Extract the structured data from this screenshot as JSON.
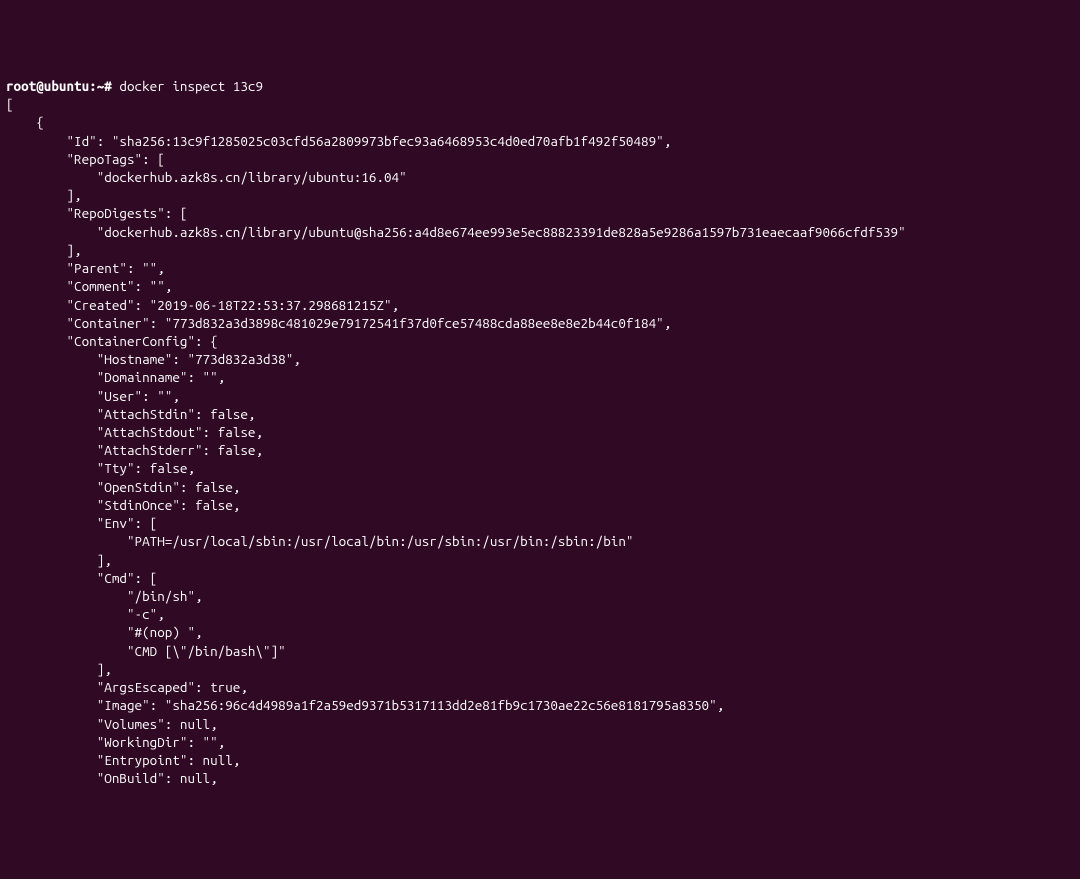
{
  "prompt": "root@ubuntu:~# ",
  "command": "docker inspect 13c9",
  "lines": [
    "[",
    "    {",
    "        \"Id\": \"sha256:13c9f1285025c03cfd56a2809973bfec93a6468953c4d0ed70afb1f492f50489\",",
    "        \"RepoTags\": [",
    "            \"dockerhub.azk8s.cn/library/ubuntu:16.04\"",
    "        ],",
    "        \"RepoDigests\": [",
    "            \"dockerhub.azk8s.cn/library/ubuntu@sha256:a4d8e674ee993e5ec88823391de828a5e9286a1597b731eaecaaf9066cfdf539\"",
    "        ],",
    "        \"Parent\": \"\",",
    "        \"Comment\": \"\",",
    "        \"Created\": \"2019-06-18T22:53:37.298681215Z\",",
    "        \"Container\": \"773d832a3d3898c481029e79172541f37d0fce57488cda88ee8e8e2b44c0f184\",",
    "        \"ContainerConfig\": {",
    "            \"Hostname\": \"773d832a3d38\",",
    "            \"Domainname\": \"\",",
    "            \"User\": \"\",",
    "            \"AttachStdin\": false,",
    "            \"AttachStdout\": false,",
    "            \"AttachStderr\": false,",
    "            \"Tty\": false,",
    "            \"OpenStdin\": false,",
    "            \"StdinOnce\": false,",
    "            \"Env\": [",
    "                \"PATH=/usr/local/sbin:/usr/local/bin:/usr/sbin:/usr/bin:/sbin:/bin\"",
    "            ],",
    "            \"Cmd\": [",
    "                \"/bin/sh\",",
    "                \"-c\",",
    "                \"#(nop) \",",
    "                \"CMD [\\\"/bin/bash\\\"]\"",
    "            ],",
    "            \"ArgsEscaped\": true,",
    "            \"Image\": \"sha256:96c4d4989a1f2a59ed9371b5317113dd2e81fb9c1730ae22c56e8181795a8350\",",
    "            \"Volumes\": null,",
    "            \"WorkingDir\": \"\",",
    "            \"Entrypoint\": null,",
    "            \"OnBuild\": null,"
  ]
}
